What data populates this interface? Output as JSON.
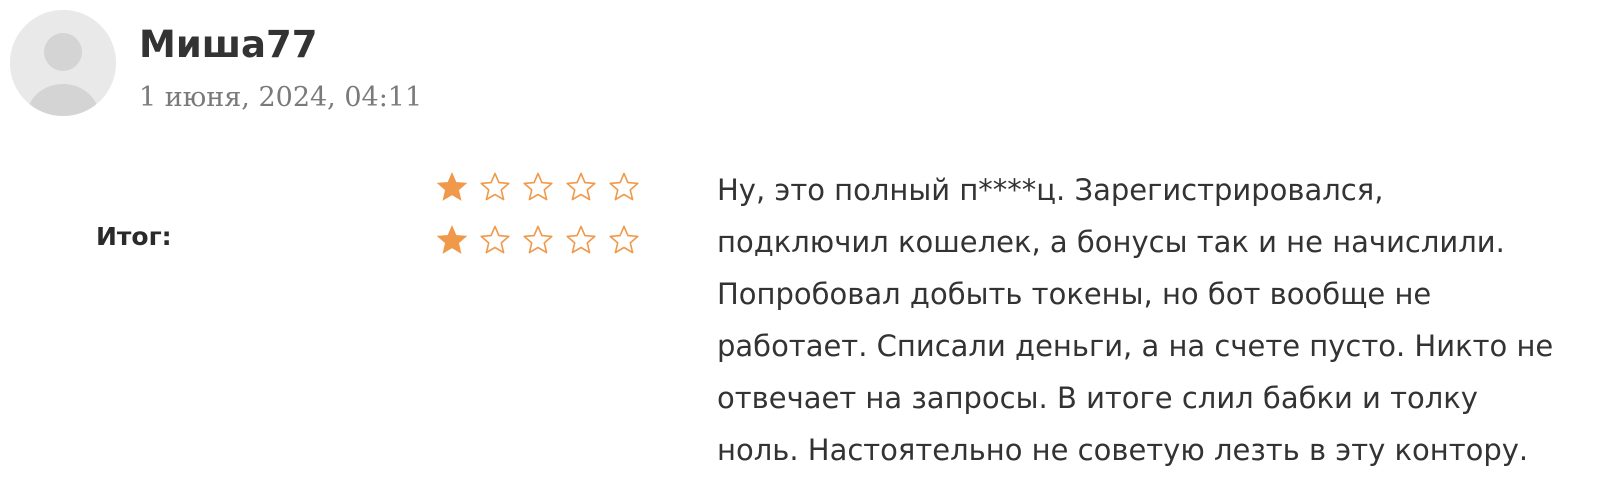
{
  "review": {
    "author": "Миша77",
    "date": "1 июня, 2024, 04:11",
    "total_label": "Итог:",
    "ratings": [
      {
        "value": 1,
        "max": 5
      },
      {
        "value": 1,
        "max": 5
      }
    ],
    "text_lines": [
      "Ну, это полный п****ц. Зарегистрировался,",
      "подключил кошелек, а бонусы так и не начислили.",
      "Попробовал добыть токены, но бот вообще не",
      "работает. Списали деньги, а на счете пусто. Никто не",
      "отвечает на запросы. В итоге слил бабки и толку",
      "ноль. Настоятельно не советую лезть в эту контору."
    ]
  },
  "colors": {
    "star": "#f0994a",
    "avatar_bg": "#e9e9e9",
    "avatar_figure": "#d4d4d4"
  },
  "icons": {
    "avatar": "user-placeholder-icon",
    "star_filled": "star-filled-icon",
    "star_empty": "star-outline-icon"
  }
}
